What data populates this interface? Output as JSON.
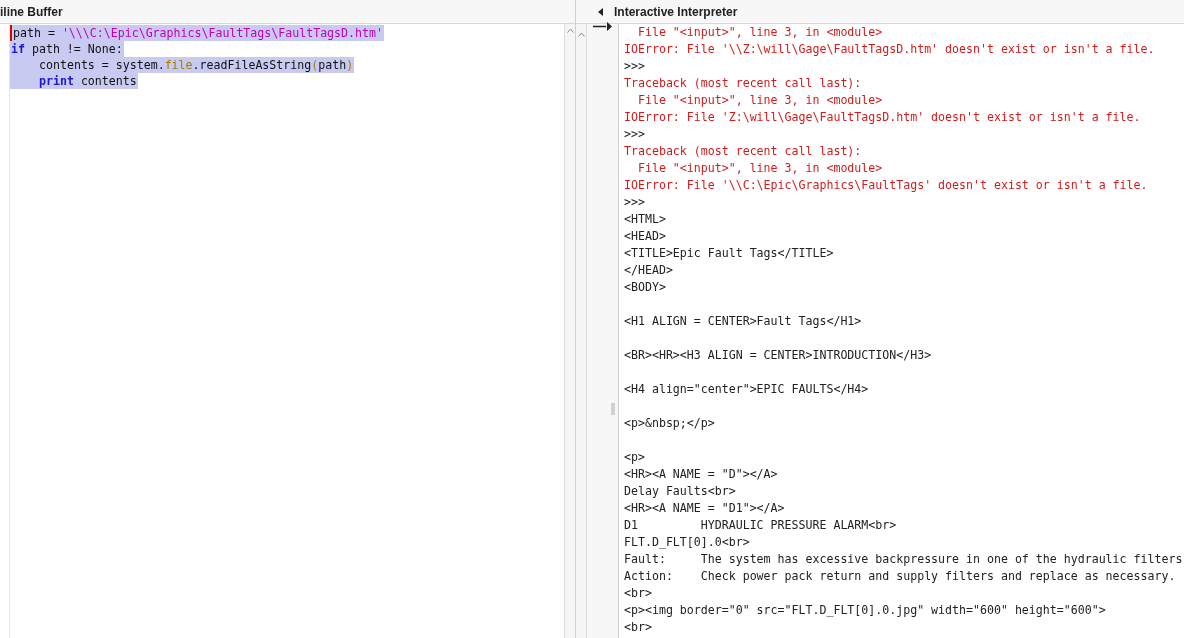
{
  "buffer": {
    "title": "iline Buffer",
    "lines": [
      {
        "selected": true,
        "cursor": true,
        "tokens": [
          {
            "kind": "plain",
            "text": "path = "
          },
          {
            "kind": "string",
            "text": "'\\\\\\C:\\Epic\\Graphics\\FaultTags\\FaultTagsD.htm'"
          }
        ]
      },
      {
        "selected": true,
        "cursor": false,
        "tokens": [
          {
            "kind": "keyword",
            "text": "if"
          },
          {
            "kind": "plain",
            "text": " path != None:"
          }
        ]
      },
      {
        "selected": true,
        "cursor": false,
        "indented": true,
        "tokens": [
          {
            "kind": "plain",
            "text": "contents = system."
          },
          {
            "kind": "module",
            "text": "file"
          },
          {
            "kind": "plain",
            "text": ".readFileAsString"
          },
          {
            "kind": "module",
            "text": "("
          },
          {
            "kind": "plain",
            "text": "path"
          },
          {
            "kind": "module",
            "text": ")"
          }
        ]
      },
      {
        "selected": true,
        "cursor": false,
        "indented": true,
        "tokens": [
          {
            "kind": "keyword",
            "text": "print"
          },
          {
            "kind": "plain",
            "text": " contents"
          }
        ]
      }
    ]
  },
  "interpreter": {
    "title": "Interactive Interpreter",
    "lines": [
      {
        "kind": "error",
        "text": "  File \"<input>\", line 3, in <module>"
      },
      {
        "kind": "error",
        "text": "IOError: File '\\\\Z:\\will\\Gage\\FaultTagsD.htm' doesn't exist or isn't a file."
      },
      {
        "kind": "output",
        "text": ">>>"
      },
      {
        "kind": "error",
        "text": "Traceback (most recent call last):"
      },
      {
        "kind": "error",
        "text": "  File \"<input>\", line 3, in <module>"
      },
      {
        "kind": "error",
        "text": "IOError: File 'Z:\\will\\Gage\\FaultTagsD.htm' doesn't exist or isn't a file."
      },
      {
        "kind": "output",
        "text": ">>>"
      },
      {
        "kind": "error",
        "text": "Traceback (most recent call last):"
      },
      {
        "kind": "error",
        "text": "  File \"<input>\", line 3, in <module>"
      },
      {
        "kind": "error",
        "text": "IOError: File '\\\\C:\\Epic\\Graphics\\FaultTags' doesn't exist or isn't a file."
      },
      {
        "kind": "output",
        "text": ">>>"
      },
      {
        "kind": "output",
        "text": "<HTML>"
      },
      {
        "kind": "output",
        "text": "<HEAD>"
      },
      {
        "kind": "output",
        "text": "<TITLE>Epic Fault Tags</TITLE>"
      },
      {
        "kind": "output",
        "text": "</HEAD>"
      },
      {
        "kind": "output",
        "text": "<BODY>"
      },
      {
        "kind": "blank"
      },
      {
        "kind": "output",
        "text": "<H1 ALIGN = CENTER>Fault Tags</H1>"
      },
      {
        "kind": "blank"
      },
      {
        "kind": "output",
        "text": "<BR><HR><H3 ALIGN = CENTER>INTRODUCTION</H3>"
      },
      {
        "kind": "blank"
      },
      {
        "kind": "output",
        "text": "<H4 align=\"center\">EPIC FAULTS</H4>"
      },
      {
        "kind": "blank"
      },
      {
        "kind": "output",
        "text": "<p>&nbsp;</p>"
      },
      {
        "kind": "blank"
      },
      {
        "kind": "output",
        "text": "<p>"
      },
      {
        "kind": "output",
        "text": "<HR><A NAME = \"D\"></A>"
      },
      {
        "kind": "output",
        "text": "Delay Faults<br>"
      },
      {
        "kind": "output",
        "text": "<HR><A NAME = \"D1\"></A>"
      },
      {
        "kind": "output",
        "text": "D1         HYDRAULIC PRESSURE ALARM<br>"
      },
      {
        "kind": "output",
        "text": "FLT.D_FLT[0].0<br>"
      },
      {
        "kind": "output",
        "text": "Fault:     The system has excessive backpressure in one of the hydraulic filters"
      },
      {
        "kind": "output",
        "text": "Action:    Check power pack return and supply filters and replace as necessary."
      },
      {
        "kind": "output",
        "text": "<br>"
      },
      {
        "kind": "output",
        "text": "<p><img border=\"0\" src=\"FLT.D_FLT[0].0.jpg\" width=\"600\" height=\"600\">"
      },
      {
        "kind": "output",
        "text": "<br>"
      }
    ]
  }
}
